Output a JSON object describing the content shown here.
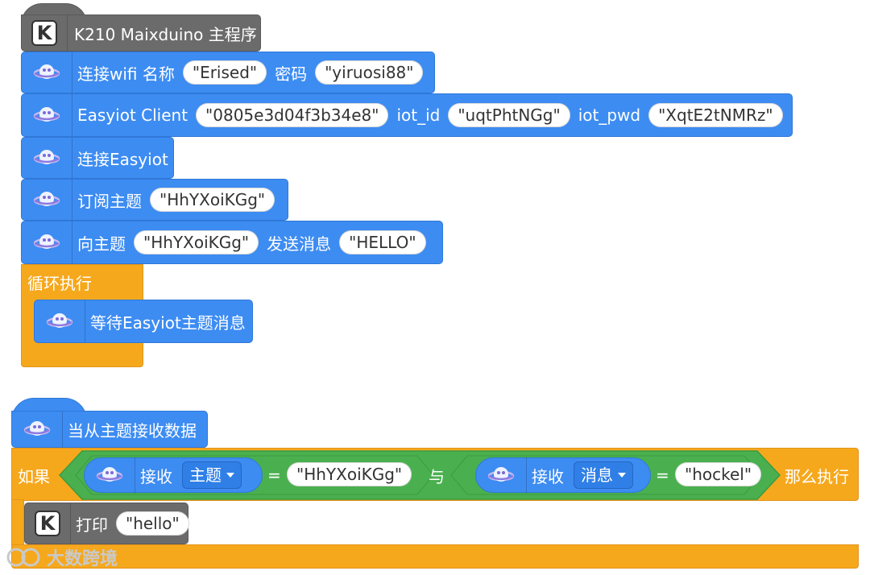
{
  "main": {
    "hat_label": "K210 Maixduino 主程序",
    "wifi": {
      "label": "连接wifi 名称",
      "ssid": "\"Erised\"",
      "pwd_label": "密码",
      "pwd": "\"yiruosi88\""
    },
    "client": {
      "label": "Easyiot Client",
      "id_value": "\"0805e3d04f3b34e8\"",
      "iot_id_label": "iot_id",
      "iot_id": "\"uqtPhtNGg\"",
      "iot_pwd_label": "iot_pwd",
      "iot_pwd": "\"XqtE2tNMRz\""
    },
    "connect": {
      "label": "连接Easyiot"
    },
    "subscribe": {
      "label": "订阅主题",
      "topic": "\"HhYXoiKGg\""
    },
    "publish": {
      "label": "向主题",
      "topic": "\"HhYXoiKGg\"",
      "mid": "发送消息",
      "message": "\"HELLO\""
    },
    "loop": {
      "label": "循环执行",
      "wait_label": "等待Easyiot主题消息"
    }
  },
  "event": {
    "hat_label": "当从主题接收数据",
    "if_label": "如果",
    "then_label": "那么执行",
    "and_label": "与",
    "cond1": {
      "receive": "接收",
      "field": "主题",
      "eq": "=",
      "value": "\"HhYXoiKGg\""
    },
    "cond2": {
      "receive": "接收",
      "field": "消息",
      "eq": "=",
      "value": "\"hockel\""
    },
    "print": {
      "label": "打印",
      "value": "\"hello\""
    }
  },
  "watermark": {
    "text": "大数跨境"
  },
  "colors": {
    "blue": "#3d8cf2",
    "orange": "#f6a81c",
    "green": "#4ab04f",
    "grey": "#6b6b6b"
  }
}
